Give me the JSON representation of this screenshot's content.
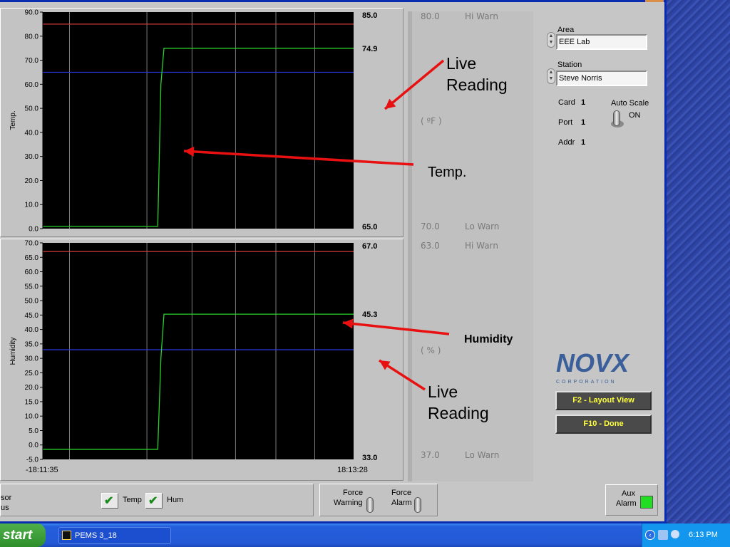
{
  "temp_chart": {
    "type": "line",
    "ylabel": "Temp.",
    "ylim": [
      0,
      90
    ],
    "yticks": [
      "0.0",
      "10.0",
      "20.0",
      "30.0",
      "40.0",
      "50.0",
      "60.0",
      "70.0",
      "80.0",
      "90.0"
    ],
    "scale_top": "85.0",
    "scale_live": "74.9",
    "scale_bottom": "65.0",
    "hi_line": 85,
    "lo_line": 65,
    "series": [
      {
        "x": [
          0,
          0.37,
          0.38,
          0.39,
          1
        ],
        "y": [
          1,
          1,
          60,
          75,
          75
        ]
      }
    ]
  },
  "hum_chart": {
    "type": "line",
    "ylabel": "Humidity",
    "ylim": [
      -5,
      70
    ],
    "yticks": [
      "-5.0",
      "0.0",
      "5.0",
      "10.0",
      "15.0",
      "20.0",
      "25.0",
      "30.0",
      "35.0",
      "40.0",
      "45.0",
      "50.0",
      "55.0",
      "60.0",
      "65.0",
      "70.0"
    ],
    "scale_top": "67.0",
    "scale_live": "45.3",
    "scale_bottom": "33.0",
    "hi_line": 67,
    "lo_line": 33,
    "series": [
      {
        "x": [
          0,
          0.37,
          0.38,
          0.39,
          1
        ],
        "y": [
          -1.5,
          -1.5,
          30,
          45.3,
          45.3
        ]
      }
    ]
  },
  "time_axis": {
    "start": "-18:11:35",
    "end": "18:13:28"
  },
  "chart_data": [
    {
      "type": "line",
      "ylabel": "Temp.",
      "ylim": [
        0,
        90
      ],
      "reference_lines": {
        "hi_warn": 85,
        "lo_warn": 65
      },
      "series": [
        {
          "x": [
            0,
            0.37,
            0.38,
            0.39,
            1
          ],
          "y": [
            1,
            1,
            60,
            75,
            75
          ]
        }
      ]
    },
    {
      "type": "line",
      "ylabel": "Humidity",
      "ylim": [
        -5,
        70
      ],
      "reference_lines": {
        "hi_warn": 67,
        "lo_warn": 33
      },
      "series": [
        {
          "x": [
            0,
            0.37,
            0.38,
            0.39,
            1
          ],
          "y": [
            -1.5,
            -1.5,
            30,
            45.3,
            45.3
          ]
        }
      ]
    }
  ],
  "readouts": {
    "temp_hi_value": "80.0",
    "temp_hi_label": "Hi Warn",
    "temp_unit": "( ºF )",
    "temp_lo_value": "70.0",
    "temp_lo_label": "Lo Warn",
    "hum_hi_value": "63.0",
    "hum_hi_label": "Hi Warn",
    "hum_unit": "( % )",
    "hum_lo_value": "37.0",
    "hum_lo_label": "Lo Warn"
  },
  "annotations": {
    "live_reading_1": "Live",
    "live_reading_1b": "Reading",
    "temp": "Temp.",
    "humidity": "Humidity",
    "live_reading_2": "Live",
    "live_reading_2b": "Reading"
  },
  "side": {
    "area_label": "Area",
    "area_value": "EEE Lab",
    "station_label": "Station",
    "station_value": "Steve Norris",
    "card_label": "Card",
    "card_value": "1",
    "port_label": "Port",
    "port_value": "1",
    "addr_label": "Addr",
    "addr_value": "1",
    "auto_scale_label": "Auto Scale",
    "auto_scale_state": "ON",
    "logo_text": "NOVX",
    "logo_sub": "CORPORATION",
    "f2_label": "F2 - Layout View",
    "f10_label": "F10 - Done"
  },
  "bottom": {
    "sensor_label_1": "sor",
    "sensor_label_2": "us",
    "temp_check": "Temp",
    "hum_check": "Hum",
    "force_warning_1": "Force",
    "force_warning_2": "Warning",
    "force_alarm_1": "Force",
    "force_alarm_2": "Alarm",
    "aux_alarm_1": "Aux",
    "aux_alarm_2": "Alarm"
  },
  "taskbar": {
    "start_label": "start",
    "task_label": "PEMS 3_18",
    "clock": "6:13 PM"
  },
  "colors": {
    "hi_line": "#d63a3a",
    "lo_line": "#2b35e0",
    "trace": "#28d228",
    "plot_bg": "#000000",
    "aux_alarm": "#22dd22",
    "arrow": "#e81010"
  }
}
